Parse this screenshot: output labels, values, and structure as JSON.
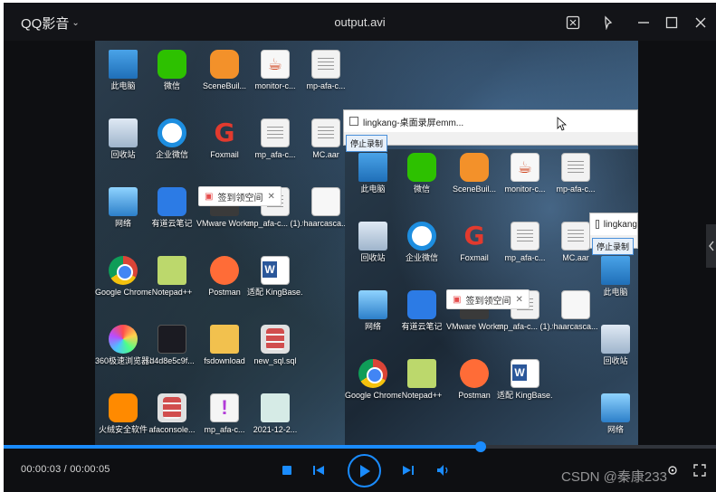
{
  "app": {
    "brand": "QQ影音",
    "title": "output.avi",
    "accent": "#1a8cff"
  },
  "window_controls": [
    "screenshot-icon",
    "pin-icon",
    "minimize-icon",
    "maximize-icon",
    "close-icon"
  ],
  "video": {
    "desktop_icons_left": [
      "此电脑",
      "微信",
      "SceneBuil...",
      "monitor-c...",
      "mp-afa-c...",
      "回收站",
      "企业微信",
      "Foxmail",
      "mp_afa-c...",
      "MC.aar",
      "网络",
      "有道云笔记",
      "VMware Workstati...",
      "mp_afa-c... (1).tpl",
      "haarcasca...",
      "Google Chrome",
      "Notepad++",
      "Postman",
      "适配 KingBase...",
      "360极速浏览器X",
      "d4d8e5c9f...",
      "fsdownload",
      "new_sql.sql",
      "火绒安全软件",
      "afaconsole...",
      "mp_afa-c...",
      "2021-12-2..."
    ],
    "desktop_icons_right": [
      "此电脑",
      "微信",
      "SceneBuil...",
      "monitor-c...",
      "mp-afa-c...",
      "回收站",
      "企业微信",
      "Foxmail",
      "mp_afa-c...",
      "MC.aar",
      "网络",
      "有道云笔记",
      "VMware Workstati...",
      "mp_afa-c... (1).tpl",
      "haarcasca...",
      "Google Chrome",
      "Notepad++",
      "Postman",
      "适配 KingBase..."
    ],
    "far_right_icons": [
      "此电脑",
      "回收站",
      "网络"
    ],
    "popup_text": "签到领空间",
    "recorder_window_title": "lingkang-桌面录屏emm...",
    "recorder_window_title_short": "lingkang",
    "recorder_button": "停止录制"
  },
  "playback": {
    "current_time": "00:00:03",
    "separator": " / ",
    "total_time": "00:00:05",
    "progress": 0.67
  },
  "watermark": "CSDN @秦康233"
}
